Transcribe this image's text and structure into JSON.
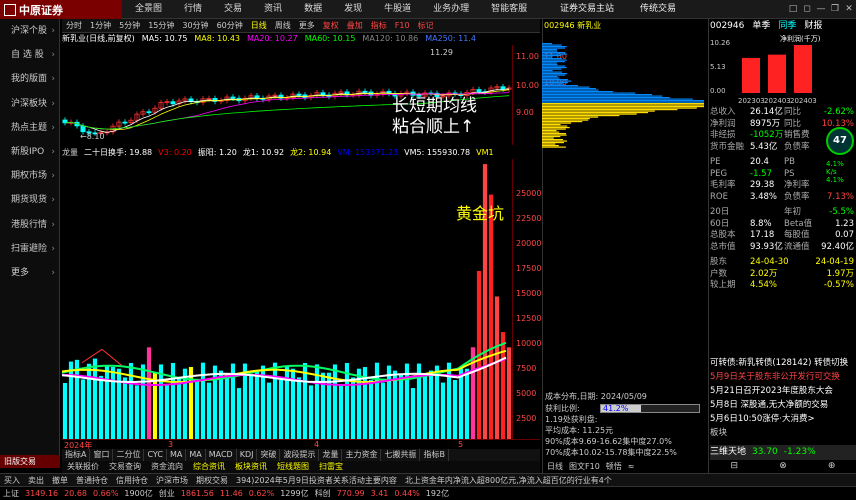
{
  "app": {
    "logo": "中原证券",
    "menu": [
      "全景图",
      "行情",
      "交易",
      "资讯",
      "数据",
      "发现",
      "牛股道",
      "业务办理",
      "智能客服"
    ],
    "top_title": "证券交易主站",
    "top_links": "传统交易",
    "window_controls": [
      "□",
      "◻",
      "—",
      "❐",
      "✕"
    ]
  },
  "sidebar": {
    "items": [
      "沪深个股",
      "自 选 股",
      "我的版面",
      "沪深板块",
      "热点主题",
      "新股IPO",
      "期权市场",
      "期货现货",
      "港股行情",
      "扫雷避险",
      "更多"
    ],
    "bottom": "旧版交易"
  },
  "periods": [
    "分时",
    "1分钟",
    "5分钟",
    "15分钟",
    "30分钟",
    "60分钟",
    "日线",
    "周线",
    "更多",
    "复权",
    "叠加",
    "指标",
    "F10",
    "标记"
  ],
  "active_period": "日线",
  "indicators": {
    "stock": "新乳业(日线,前复权)",
    "ma": [
      {
        "label": "MA5: 10.75",
        "color": "#ffffff"
      },
      {
        "label": "MA8: 10.43",
        "color": "#ffff00"
      },
      {
        "label": "MA20: 10.27",
        "color": "#ff00ff"
      },
      {
        "label": "MA60: 10.15",
        "color": "#00ff00"
      },
      {
        "label": "MA120: 10.86",
        "color": "#888888"
      },
      {
        "label": "MA250: 11.4",
        "color": "#4477ff"
      }
    ]
  },
  "kchart": {
    "ylabels": [
      "11.00",
      "10.00",
      "9.00"
    ],
    "high_label": "11.29",
    "low_label": "8.10"
  },
  "sub1": {
    "items": [
      {
        "label": "龙量",
        "color": "#cccccc"
      },
      {
        "label": "二十日换手: 19.88",
        "color": "#ffffff"
      },
      {
        "label": "V3: 0.20",
        "color": "#ff0000"
      },
      {
        "label": "振阳: 1.20",
        "color": "#ffffff"
      },
      {
        "label": "龙1: 10.92",
        "color": "#ffffff"
      },
      {
        "label": "龙2: 10.94",
        "color": "#ffff00"
      },
      {
        "label": "VM: 153371.23",
        "color": "#0000ff"
      },
      {
        "label": "VM5: 155930.78",
        "color": "#ffffff"
      },
      {
        "label": "VM1",
        "color": "#ffff00"
      }
    ]
  },
  "vol_axis": [
    "25000",
    "22500",
    "20000",
    "17500",
    "15000",
    "12500",
    "10000",
    "7500",
    "5000",
    "2500"
  ],
  "dates": [
    "2024年",
    "3",
    "4",
    "5"
  ],
  "annotations": {
    "a1_line1": "长短期均线",
    "a1_line2": "粘合顺上↑",
    "a2": "黄金坑"
  },
  "tabs": [
    "指标A",
    "窗口",
    "二分位",
    "CYC",
    "MA",
    "MA",
    "MACD",
    "KDJ",
    "突破",
    "波段提示",
    "龙量",
    "主力资金",
    "七搬共振",
    "指标B"
  ],
  "tabs2": [
    "关联报价",
    "交易查询",
    "资金流向",
    "综合资讯",
    "板块资讯",
    "短线题图",
    "扫雷宝"
  ],
  "tabs2_highlight": [
    "综合资讯",
    "板块资讯",
    "短线题图",
    "扫雷宝"
  ],
  "chip": {
    "header": "002946 新乳业",
    "ylabels": [
      "11.00",
      "10.00"
    ],
    "date_line": "成本分布,日期: 2024/05/09",
    "profit_label": "获利比例:",
    "profit_value": "41.2%",
    "profit_fraction": 0.412,
    "info": [
      "1.19处获利盘:",
      "平均成本: 11.25元",
      "90%成本9.69-16.62集中度27.0%",
      "70%成本10.02-15.78集中度22.5%"
    ],
    "tabs": [
      "日线",
      "图文F10",
      "顿悟",
      "≈"
    ]
  },
  "rpanel": {
    "head": {
      "code": "002946",
      "t1": "单季",
      "t2": "同季",
      "t3": "财报",
      "t4": "净利润(千万)"
    },
    "bars": {
      "labels": [
        "202303",
        "202403",
        "202403"
      ],
      "ylabels": [
        "10.26",
        "5.13",
        "0.00"
      ],
      "values": [
        7.5,
        8.2,
        10.26
      ]
    },
    "rows": [
      {
        "l": "总收入",
        "v1": "26.14亿",
        "l2": "同比",
        "v2": "-2.62%"
      },
      {
        "l": "净利润",
        "v1": "8975万",
        "l2": "同比",
        "v2": "10.13%"
      },
      {
        "l": "非经损",
        "v1": "-1052万",
        "l2": "销售费",
        "v2": ""
      },
      {
        "l": "货币金融",
        "v1": "5.43亿",
        "l2": "负债率",
        "v2": ""
      },
      {
        "l": "PE",
        "v1": "20.4",
        "l2": "PB",
        "v2": ""
      },
      {
        "l": "PEG",
        "v1": "-1.57",
        "l2": "PS",
        "v2": ""
      },
      {
        "l": "毛利率",
        "v1": "29.38",
        "l2": "净利率",
        "v2": ""
      },
      {
        "l": "ROE",
        "v1": "3.48%",
        "l2": "负债率",
        "v2": "7.13%"
      },
      {
        "l": "20日",
        "v1": "",
        "l2": "年初",
        "v2": "-5.5%"
      },
      {
        "l": "60日",
        "v1": "8.8%",
        "l2": "Beta值",
        "v2": "1.23"
      },
      {
        "l": "总股本",
        "v1": "17.18",
        "l2": "每股值",
        "v2": "0.07"
      },
      {
        "l": "总市值",
        "v1": "93.93亿",
        "l2": "流通值",
        "v2": "92.40亿"
      },
      {
        "l": "股东",
        "v1": "24-04-30",
        "l2": "",
        "v2": "24-04-19"
      },
      {
        "l": "户数",
        "v1": "2.02万",
        "l2": "",
        "v2": "1.97万"
      },
      {
        "l": "较上期",
        "v1": "4.54%",
        "l2": "",
        "v2": "-0.57%"
      }
    ],
    "gauge": "47",
    "ministats": [
      "4.1%",
      "K/s",
      "4.1%"
    ],
    "news": [
      {
        "t": "可转债:新乳转债(128142) 转债切换",
        "c": "#ffffff"
      },
      {
        "t": "5月9日关于股东非公开发行可交换",
        "c": "#ff4444"
      },
      {
        "t": "5月21日召开2023年度股东大会",
        "c": "#ffffff"
      },
      {
        "t": "5月8日 深股通,无大净额的交易",
        "c": "#ffffff"
      },
      {
        "t": "5月6日10:50涨停·大消费>",
        "c": "#ffffff"
      },
      {
        "t": "板块",
        "c": "#cccccc"
      }
    ],
    "bottom": {
      "name": "三维天地",
      "price": "33.70",
      "change": "-1.23%"
    },
    "tabs2": [
      "⊟",
      "⊗",
      "⊕"
    ]
  },
  "statusbar": [
    "买入",
    "卖出",
    "撤单",
    "普通持仓",
    "信用持仓",
    "沪深市场",
    "期权交易",
    "394)2024年5月9日投资者关系活动主要内容",
    "北上资金年内净流入超800亿元,净流入超百亿的行业有4个"
  ],
  "indexbar": [
    {
      "t": "上证",
      "c": "#ccc"
    },
    {
      "t": "3149.16",
      "c": "#f44"
    },
    {
      "t": "20.68",
      "c": "#f44"
    },
    {
      "t": "0.66%",
      "c": "#f44"
    },
    {
      "t": "1900亿",
      "c": "#ccc"
    },
    {
      "t": "创业",
      "c": "#ccc"
    },
    {
      "t": "1861.56",
      "c": "#f44"
    },
    {
      "t": "11.46",
      "c": "#f44"
    },
    {
      "t": "0.62%",
      "c": "#f44"
    },
    {
      "t": "1299亿",
      "c": "#ccc"
    },
    {
      "t": "科创",
      "c": "#ccc"
    },
    {
      "t": "770.99",
      "c": "#f44"
    },
    {
      "t": "3.41",
      "c": "#f44"
    },
    {
      "t": "0.44%",
      "c": "#f44"
    },
    {
      "t": "192亿",
      "c": "#ccc"
    }
  ],
  "colors": {
    "up": "#ff4444",
    "down": "#00ff00",
    "cyan": "#00ffff",
    "yellow": "#ffff00"
  }
}
